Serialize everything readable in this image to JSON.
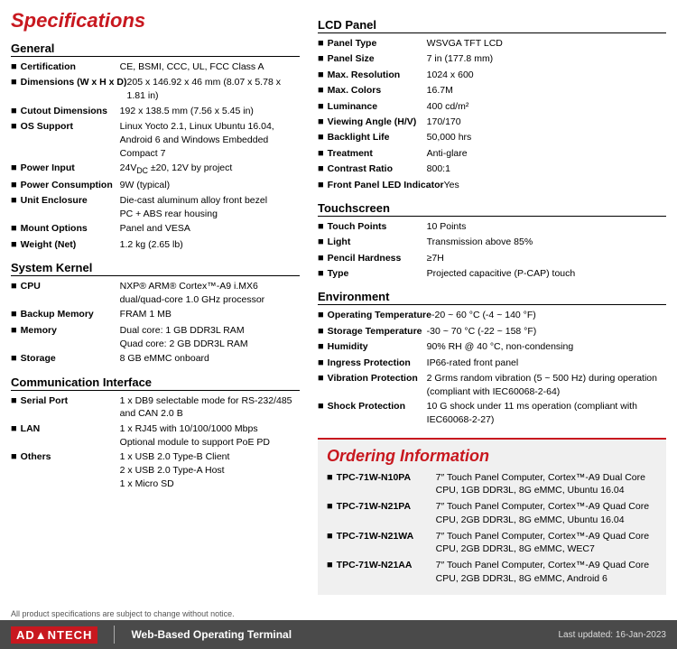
{
  "page": {
    "title": "Specifications"
  },
  "left": {
    "general": {
      "title": "General",
      "items": [
        {
          "label": "Certification",
          "value": "CE, BSMI, CCC, UL, FCC Class A"
        },
        {
          "label": "Dimensions (W x H x D)",
          "value": "205 x 146.92 x 46 mm (8.07 x 5.78 x 1.81 in)"
        },
        {
          "label": "Cutout Dimensions",
          "value": "192 x 138.5 mm (7.56 x 5.45 in)"
        },
        {
          "label": "OS Support",
          "value": "Linux Yocto 2.1, Linux Ubuntu 16.04, Android 6 and Windows Embedded Compact 7"
        },
        {
          "label": "Power Input",
          "value": "24V± ±20, 12V by project"
        },
        {
          "label": "Power Consumption",
          "value": "9W (typical)"
        },
        {
          "label": "Unit Enclosure",
          "value": "Die-cast aluminum alloy front bezel\nPC + ABS rear housing"
        },
        {
          "label": "Mount Options",
          "value": "Panel and VESA"
        },
        {
          "label": "Weight (Net)",
          "value": "1.2 kg (2.65 lb)"
        }
      ]
    },
    "system_kernel": {
      "title": "System Kernel",
      "items": [
        {
          "label": "CPU",
          "value": "NXP® ARM® Cortex™-A9 i.MX6 dual/quad-core 1.0 GHz processor"
        },
        {
          "label": "Backup Memory",
          "value": "FRAM 1 MB"
        },
        {
          "label": "Memory",
          "value": "Dual core: 1 GB DDR3L RAM\nQuad core: 2 GB DDR3L RAM"
        },
        {
          "label": "Storage",
          "value": "8 GB eMMC onboard"
        }
      ]
    },
    "communication": {
      "title": "Communication Interface",
      "items": [
        {
          "label": "Serial Port",
          "value": "1 x DB9 selectable mode for RS-232/485 and CAN 2.0 B"
        },
        {
          "label": "LAN",
          "value": "1 x RJ45 with 10/100/1000 Mbps\nOptional module to support PoE PD"
        },
        {
          "label": "Others",
          "value": "1 x USB 2.0 Type-B Client\n2 x USB 2.0 Type-A Host\n1 x Micro SD"
        }
      ]
    }
  },
  "right": {
    "lcd_panel": {
      "title": "LCD Panel",
      "items": [
        {
          "label": "Panel Type",
          "value": "WSVGA TFT LCD"
        },
        {
          "label": "Panel Size",
          "value": "7 in (177.8 mm)"
        },
        {
          "label": "Max. Resolution",
          "value": "1024 x 600"
        },
        {
          "label": "Max. Colors",
          "value": "16.7M"
        },
        {
          "label": "Luminance",
          "value": "400 cd/m²"
        },
        {
          "label": "Viewing Angle (H/V)",
          "value": "170/170"
        },
        {
          "label": "Backlight Life",
          "value": "50,000 hrs"
        },
        {
          "label": "Treatment",
          "value": "Anti-glare"
        },
        {
          "label": "Contrast Ratio",
          "value": "800:1"
        },
        {
          "label": "Front Panel LED Indicator",
          "value": "Yes"
        }
      ]
    },
    "touchscreen": {
      "title": "Touchscreen",
      "items": [
        {
          "label": "Touch Points",
          "value": "10 Points"
        },
        {
          "label": "Light",
          "value": "Transmission above 85%"
        },
        {
          "label": "Pencil Hardness",
          "value": "≥7H"
        },
        {
          "label": "Type",
          "value": "Projected capacitive (P-CAP) touch"
        }
      ]
    },
    "environment": {
      "title": "Environment",
      "items": [
        {
          "label": "Operating Temperature",
          "value": "-20 ~ 60 °C (-4 ~ 140 °F)"
        },
        {
          "label": "Storage Temperature",
          "value": "-30 ~ 70 °C (-22 ~ 158 °F)"
        },
        {
          "label": "Humidity",
          "value": "90% RH @ 40 °C, non-condensing"
        },
        {
          "label": "Ingress Protection",
          "value": "IP66-rated front panel"
        },
        {
          "label": "Vibration Protection",
          "value": "2 Grms random vibration (5 ~ 500 Hz) during operation (compliant with IEC60068-2-64)"
        },
        {
          "label": "Shock Protection",
          "value": "10 G shock under 11 ms operation (compliant with IEC60068-2-27)"
        }
      ]
    }
  },
  "ordering": {
    "title": "Ordering Information",
    "items": [
      {
        "model": "TPC-71W-N10PA",
        "desc": "7″ Touch Panel Computer, Cortex™-A9 Dual Core CPU, 1GB DDR3L, 8G eMMC, Ubuntu 16.04"
      },
      {
        "model": "TPC-71W-N21PA",
        "desc": "7″ Touch Panel Computer, Cortex™-A9 Quad Core CPU, 2GB DDR3L, 8G eMMC, Ubuntu 16.04"
      },
      {
        "model": "TPC-71W-N21WA",
        "desc": "7″ Touch Panel Computer, Cortex™-A9 Quad Core CPU, 2GB DDR3L, 8G eMMC, WEC7"
      },
      {
        "model": "TPC-71W-N21AA",
        "desc": "7″ Touch Panel Computer, Cortex™-A9 Quad Core CPU, 2GB DDR3L, 8G eMMC, Android 6"
      }
    ]
  },
  "footer": {
    "brand": "AD▲NTECH",
    "tagline": "Web-Based Operating Terminal",
    "note": "All product specifications are subject to change without notice.",
    "updated": "Last updated: 16-Jan-2023"
  }
}
